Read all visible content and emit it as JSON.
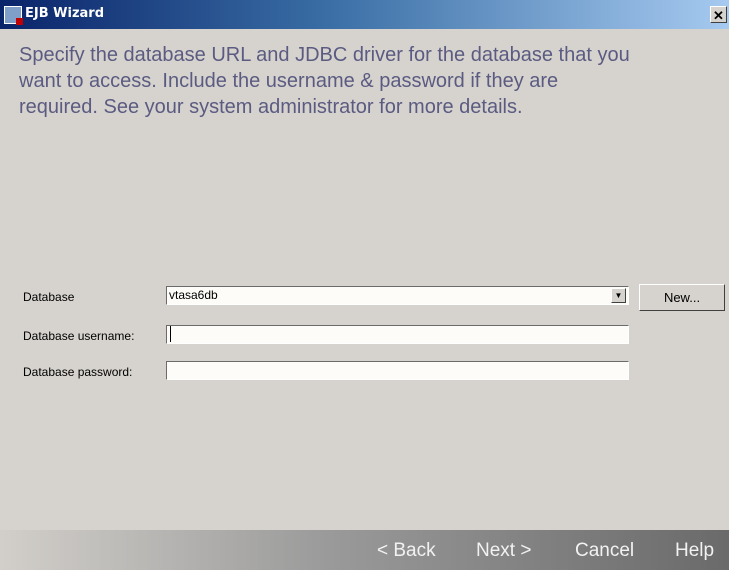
{
  "window": {
    "title": "EJB Wizard",
    "close_glyph": "✕"
  },
  "instruction": "Specify the database URL and JDBC driver for the database that you\nwant to access.  Include the username & password if they are\nrequired.  See your system administrator for more details.",
  "form": {
    "database_label": "Database",
    "database_value": "vtasa6db",
    "dropdown_glyph": "▼",
    "new_button_label": "New...",
    "username_label": "Database username:",
    "username_value": "",
    "password_label": "Database password:",
    "password_value": ""
  },
  "buttons": {
    "back": "< Back",
    "next": "Next >",
    "cancel": "Cancel",
    "help": "Help"
  }
}
